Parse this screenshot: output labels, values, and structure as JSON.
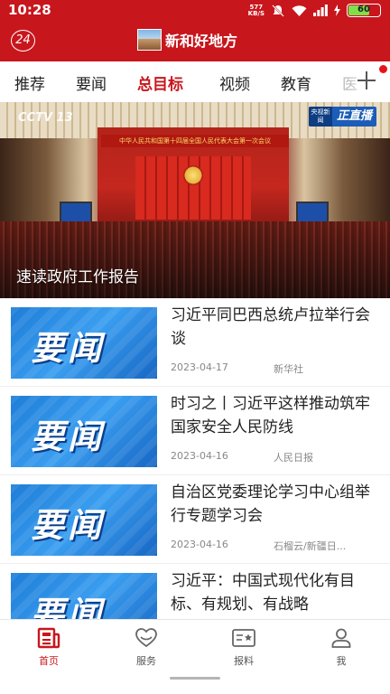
{
  "status_bar": {
    "time": "10:28",
    "net_speed_value": "577",
    "net_speed_unit": "KB/S",
    "battery": "60"
  },
  "header": {
    "badge": "24",
    "title": "新和好地方"
  },
  "tabs": [
    {
      "label": "推荐",
      "active": false
    },
    {
      "label": "要闻",
      "active": false
    },
    {
      "label": "总目标",
      "active": true
    },
    {
      "label": "视频",
      "active": false
    },
    {
      "label": "教育",
      "active": false
    },
    {
      "label": "医",
      "active": false
    }
  ],
  "hero": {
    "caption": "速读政府工作报告",
    "banner_text": "中华人民共和国第十四届全国人民代表大会第一次会议",
    "broadcaster": "CCTV 13",
    "live_badge_left": "央视新闻",
    "live_badge_right": "正直播"
  },
  "news": [
    {
      "thumb_text": "要闻",
      "title": "习近平同巴西总统卢拉举行会谈",
      "date": "2023-04-17",
      "source": "新华社"
    },
    {
      "thumb_text": "要闻",
      "title": "时习之丨习近平这样推动筑牢国家安全人民防线",
      "date": "2023-04-16",
      "source": "人民日报"
    },
    {
      "thumb_text": "要闻",
      "title": "自治区党委理论学习中心组举行专题学习会",
      "date": "2023-04-16",
      "source": "石榴云/新疆日..."
    },
    {
      "thumb_text": "要闻",
      "title": "习近平：中国式现代化有目标、有规划、有战略",
      "date": "",
      "source": ""
    }
  ],
  "bottom_nav": [
    {
      "label": "首页",
      "icon": "home-news-icon",
      "active": true
    },
    {
      "label": "服务",
      "icon": "service-heart-icon",
      "active": false
    },
    {
      "label": "报料",
      "icon": "report-icon",
      "active": false
    },
    {
      "label": "我",
      "icon": "user-icon",
      "active": false
    }
  ],
  "colors": {
    "brand_red": "#c8161d",
    "thumb_blue": "#1e7dd8"
  }
}
